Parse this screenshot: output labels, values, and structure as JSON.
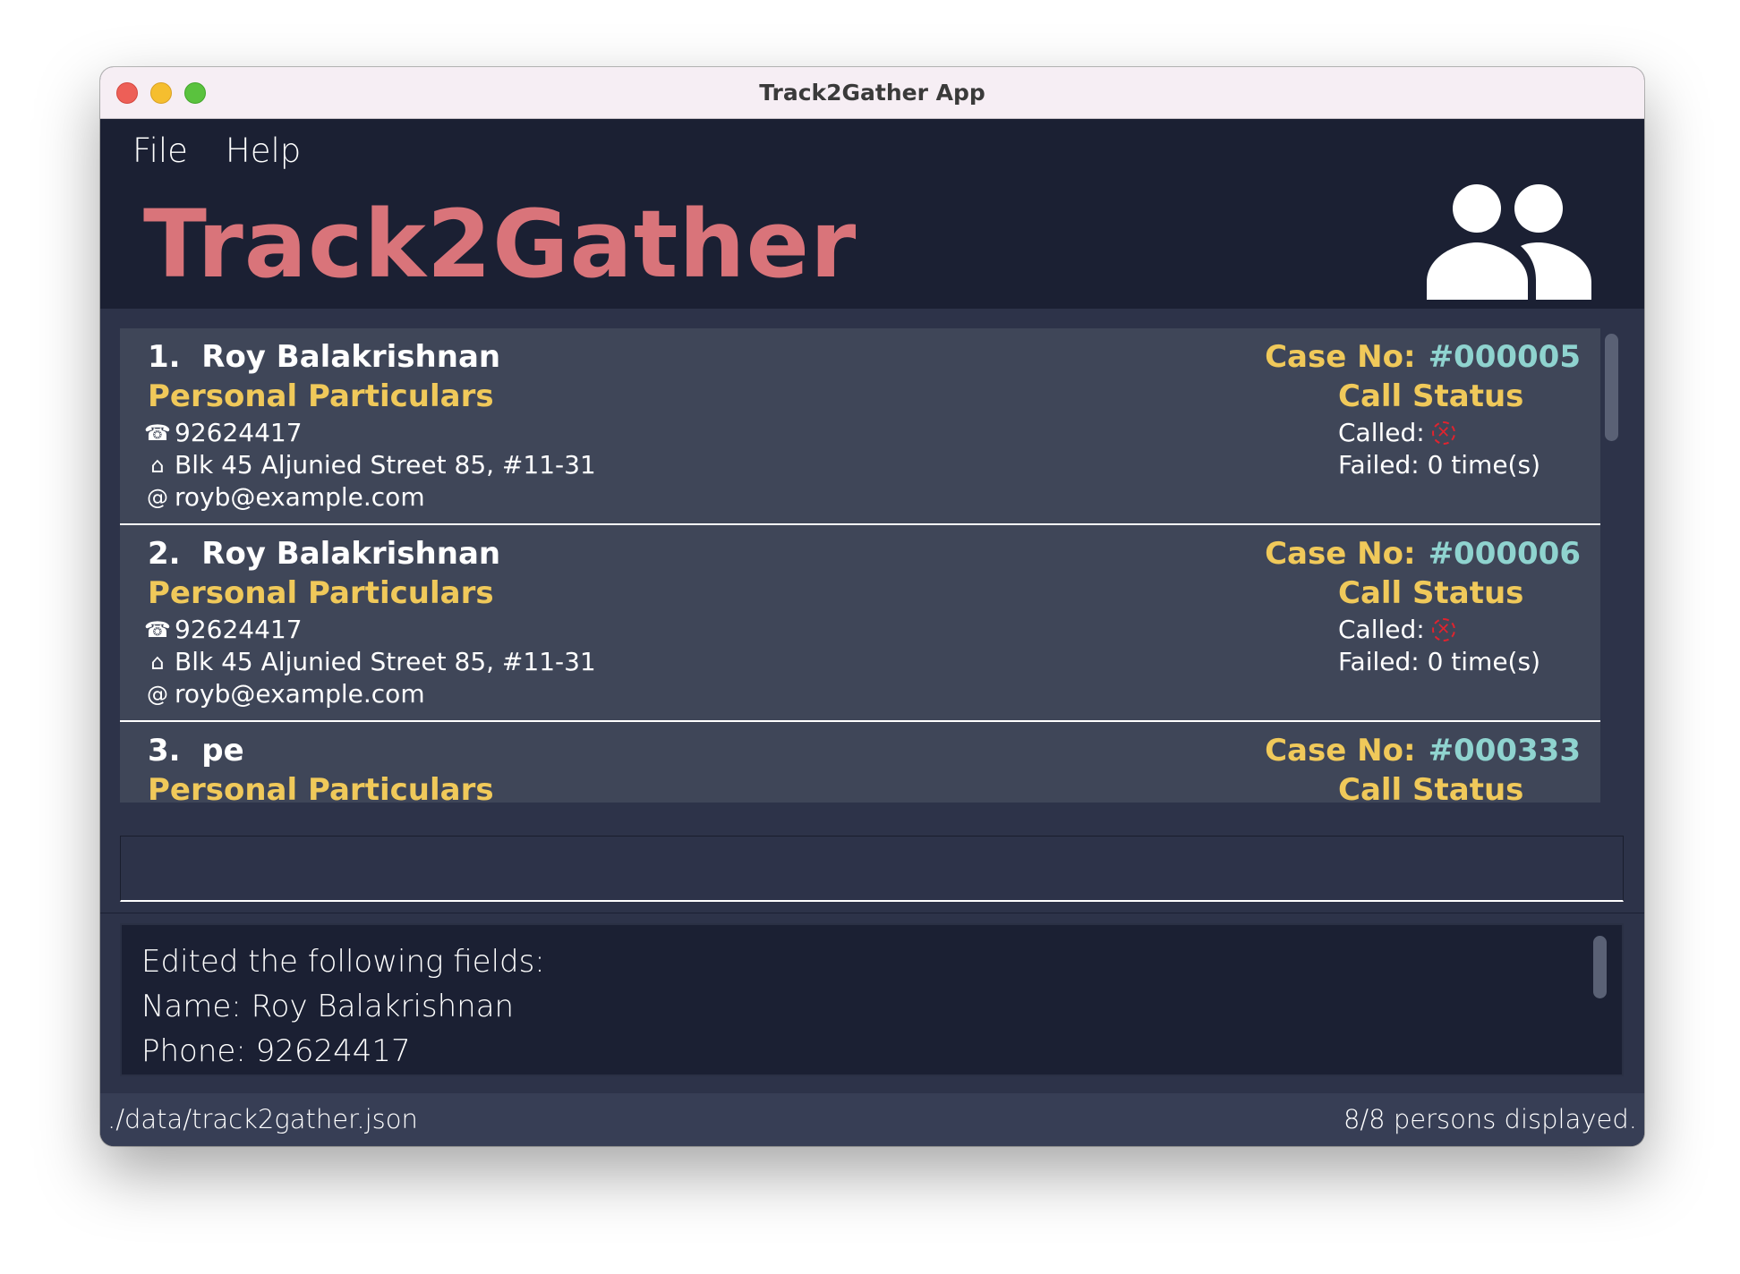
{
  "window": {
    "title": "Track2Gather App"
  },
  "menu": {
    "file": "File",
    "help": "Help"
  },
  "header": {
    "app_name": "Track2Gather",
    "icon": "people-icon"
  },
  "persons": [
    {
      "index": "1.",
      "name": "Roy Balakrishnan",
      "section_label": "Personal Particulars",
      "phone": "92624417",
      "address": "Blk 45 Aljunied Street 85, #11-31",
      "email": "royb@example.com",
      "case_label": "Case No:",
      "case_no": "#000005",
      "call_status_label": "Call Status",
      "called_label": "Called:",
      "failed": "Failed: 0 time(s)"
    },
    {
      "index": "2.",
      "name": "Roy Balakrishnan",
      "section_label": "Personal Particulars",
      "phone": "92624417",
      "address": "Blk 45 Aljunied Street 85, #11-31",
      "email": "royb@example.com",
      "case_label": "Case No:",
      "case_no": "#000006",
      "call_status_label": "Call Status",
      "called_label": "Called:",
      "failed": "Failed: 0 time(s)"
    },
    {
      "index": "3.",
      "name": "pe",
      "section_label": "Personal Particulars",
      "case_label": "Case No:",
      "case_no": "#000333",
      "call_status_label": "Call Status"
    }
  ],
  "command_box": {
    "value": ""
  },
  "result": {
    "lines": [
      "Edited the following fields:",
      "Name: Roy Balakrishnan",
      "Phone: 92624417"
    ]
  },
  "status_bar": {
    "file_path": "./data/track2gather.json",
    "count": "8/8 persons displayed."
  },
  "colors": {
    "background": "#1b2033",
    "accent_title": "#d9747a",
    "accent_label": "#f0c95a",
    "case_number": "#8fd3cf",
    "card": "#3f4658",
    "not_called": "#e0232e"
  }
}
